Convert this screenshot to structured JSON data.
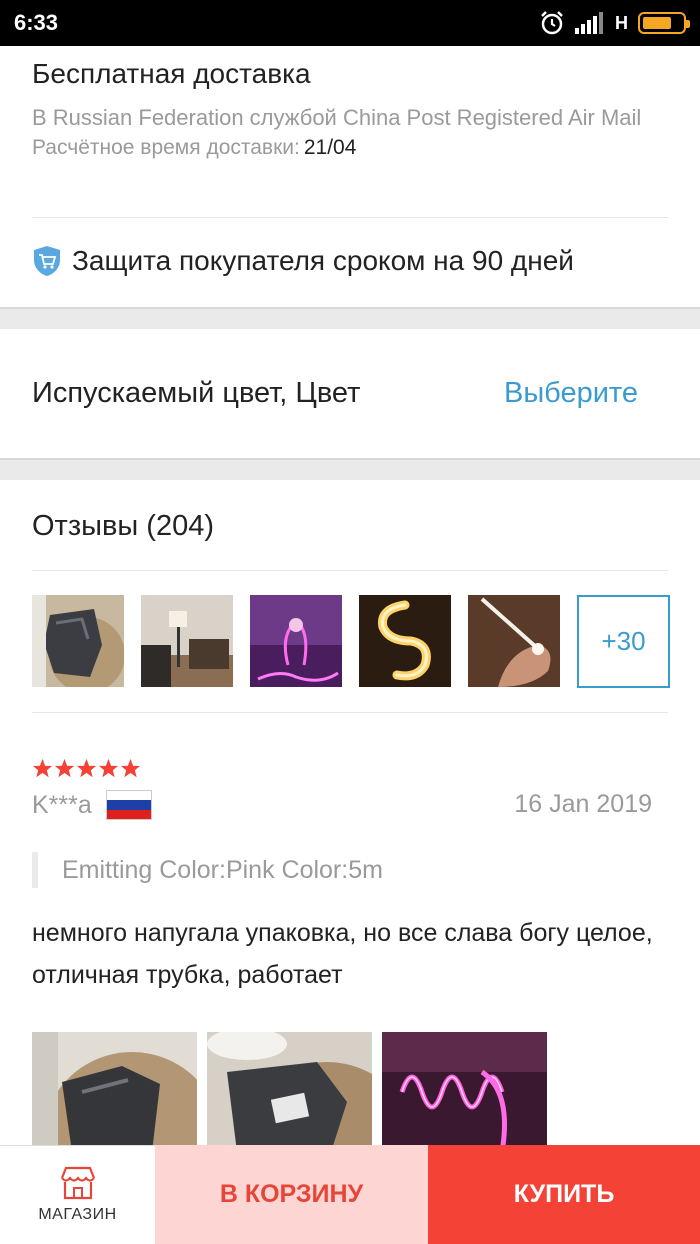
{
  "status_bar": {
    "time": "6:33",
    "network": "H"
  },
  "shipping": {
    "title": "Бесплатная доставка",
    "method": "В Russian Federation службой China Post Registered Air Mail",
    "eta_label": "Расчётное время доставки:",
    "eta_date": "21/04"
  },
  "protection": {
    "text": "Защита покупателя сроком на 90 дней"
  },
  "color_option": {
    "label": "Испускаемый цвет, Цвет",
    "action": "Выберите"
  },
  "reviews": {
    "heading": "Отзывы (204)",
    "more_photos": "+30",
    "review": {
      "rating": 5,
      "author": "K***a",
      "date": "16 Jan 2019",
      "variant": "Emitting Color:Pink Color:5m",
      "text": "немного напугала упаковка, но все слава богу целое, отличная трубка, работает"
    }
  },
  "bottom_bar": {
    "shop_label": "МАГАЗИН",
    "cart_label": "В КОРЗИНУ",
    "buy_label": "КУПИТЬ"
  },
  "colors": {
    "accent_blue": "#3a9bd1",
    "star_red": "#f44336",
    "buy_red": "#f44336",
    "cart_pink": "#fdd5d2",
    "shield_blue": "#5aa8e0"
  }
}
